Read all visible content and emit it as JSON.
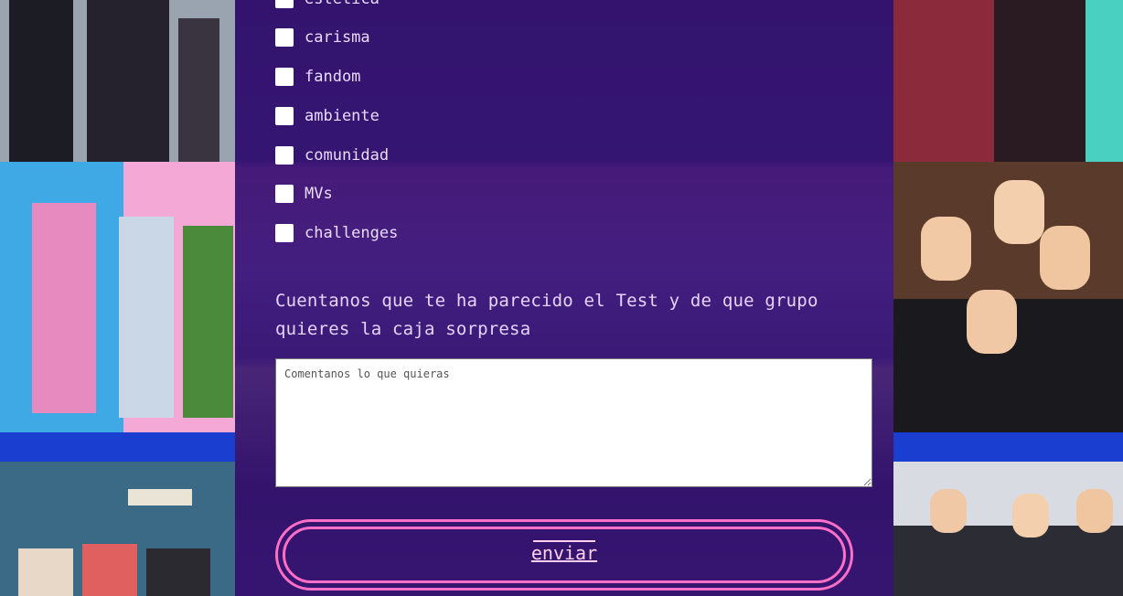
{
  "interests": [
    {
      "label": "estética",
      "checked": false
    },
    {
      "label": "carisma",
      "checked": false
    },
    {
      "label": "fandom",
      "checked": false
    },
    {
      "label": "ambiente",
      "checked": false
    },
    {
      "label": "comunidad",
      "checked": false
    },
    {
      "label": "MVs",
      "checked": false
    },
    {
      "label": "challenges",
      "checked": false
    }
  ],
  "comment": {
    "label": "Cuentanos que te ha parecido el Test y de que grupo quieres la caja sorpresa",
    "placeholder": "Comentanos lo que quieras",
    "value": ""
  },
  "submit": {
    "label": "enviar"
  },
  "colors": {
    "accent": "#ff6ec7",
    "overlay": "#341278",
    "stripe": "#1a3fd0"
  }
}
